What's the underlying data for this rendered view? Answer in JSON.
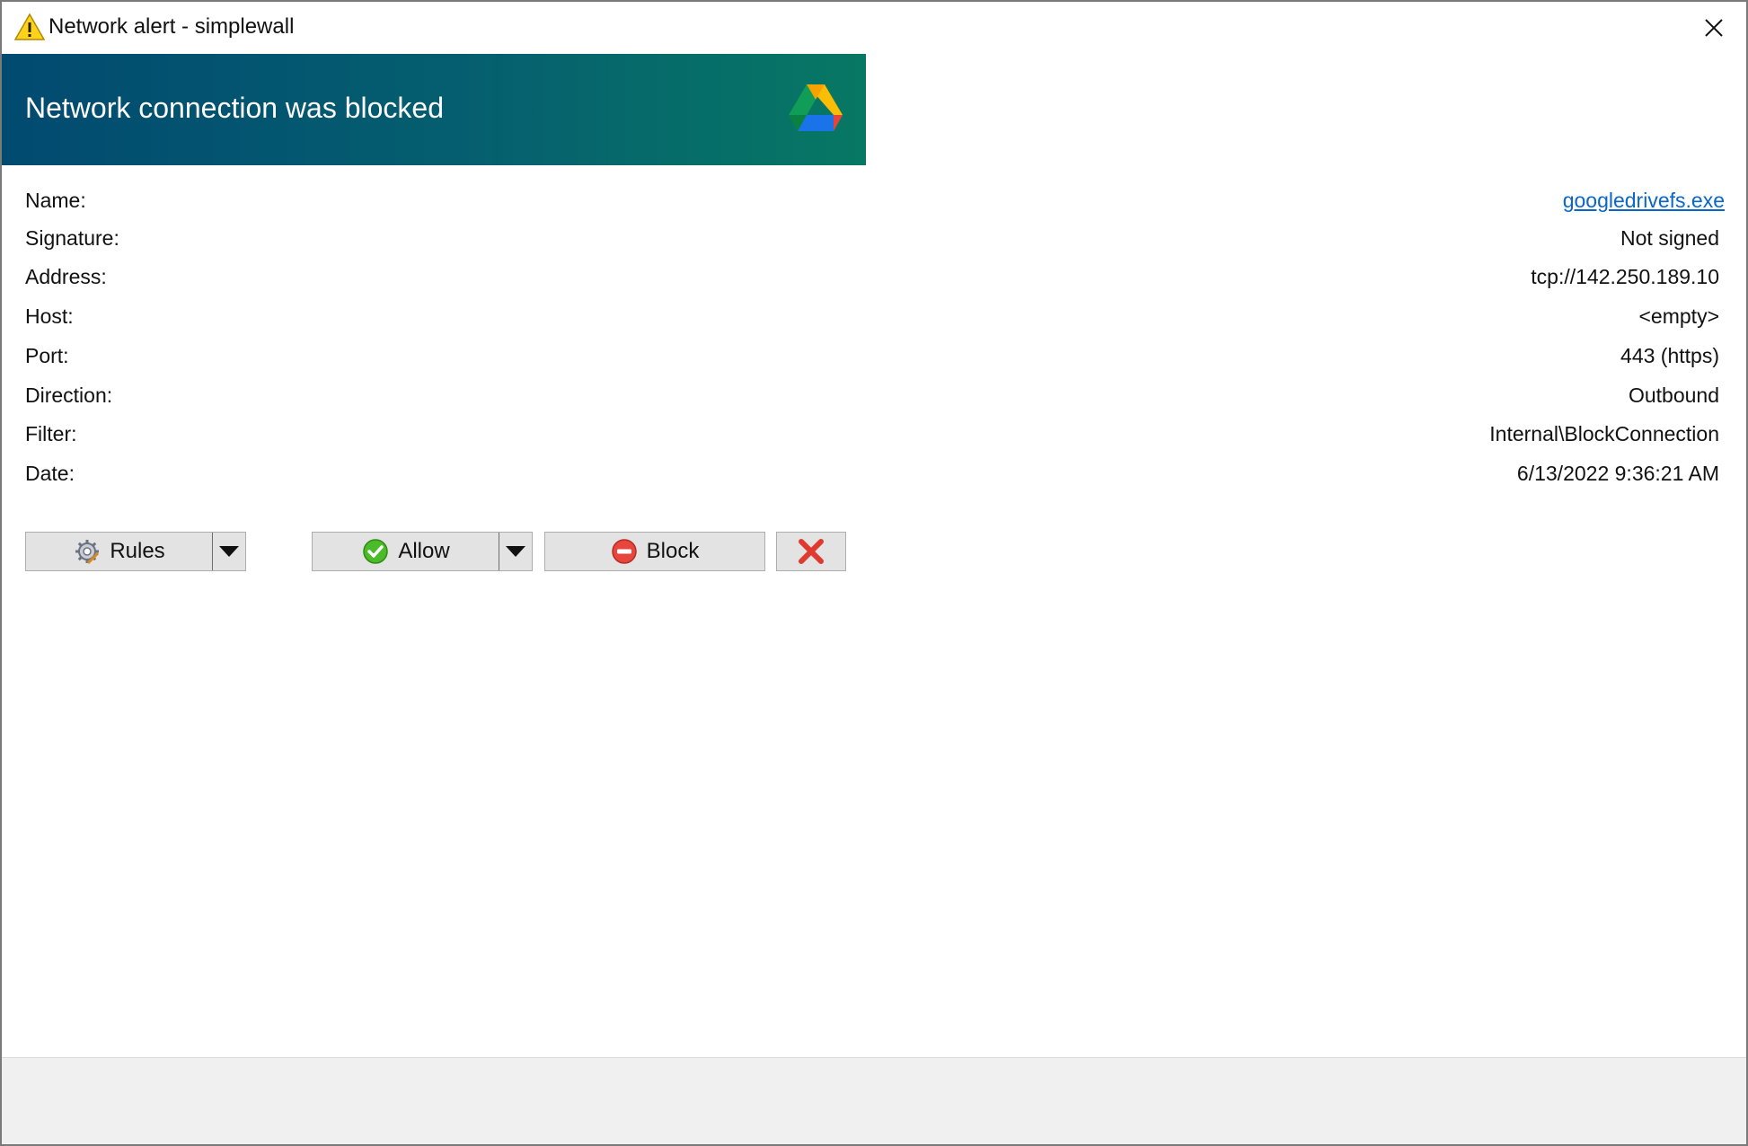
{
  "window": {
    "title": "Network alert - simplewall",
    "icon": "warning-icon"
  },
  "banner": {
    "title": "Network connection was blocked",
    "logo": "google-drive-icon"
  },
  "details": [
    {
      "label": "Name:",
      "value": "googledrivefs.exe",
      "link": true
    },
    {
      "label": "Signature:",
      "value": "Not signed"
    },
    {
      "label": "Address:",
      "value": "tcp://142.250.189.10"
    },
    {
      "label": "Host:",
      "value": "<empty>"
    },
    {
      "label": "Port:",
      "value": "443 (https)"
    },
    {
      "label": "Direction:",
      "value": "Outbound"
    },
    {
      "label": "Filter:",
      "value": "Internal\\BlockConnection"
    },
    {
      "label": "Date:",
      "value": "6/13/2022 9:36:21 AM"
    }
  ],
  "buttons": {
    "rules": {
      "label": "Rules",
      "icon": "gear-icon"
    },
    "allow": {
      "label": "Allow",
      "icon": "check-circle-icon"
    },
    "block": {
      "label": "Block",
      "icon": "minus-circle-icon"
    },
    "dismiss": {
      "icon": "red-x-icon"
    }
  },
  "colors": {
    "banner_start": "#014a70",
    "banner_end": "#077864",
    "link": "#0a66c8"
  }
}
